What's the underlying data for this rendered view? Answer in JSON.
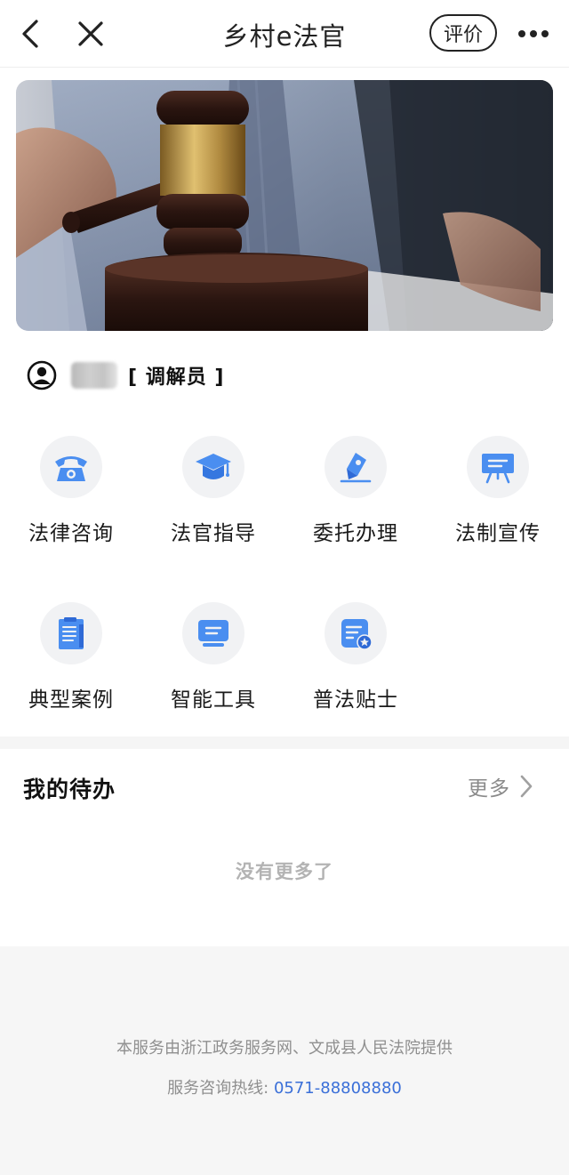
{
  "header": {
    "title": "乡村e法官",
    "rate_label": "评价"
  },
  "user": {
    "role": "[ 调解员 ]"
  },
  "services": [
    {
      "label": "法律咨询",
      "icon": "telephone-icon"
    },
    {
      "label": "法官指导",
      "icon": "graduation-cap-icon"
    },
    {
      "label": "委托办理",
      "icon": "pen-sign-icon"
    },
    {
      "label": "法制宣传",
      "icon": "presentation-board-icon"
    },
    {
      "label": "典型案例",
      "icon": "clipboard-document-icon"
    },
    {
      "label": "智能工具",
      "icon": "computer-terminal-icon"
    },
    {
      "label": "普法贴士",
      "icon": "note-star-icon"
    }
  ],
  "todo": {
    "title": "我的待办",
    "more_label": "更多",
    "empty_text": "没有更多了"
  },
  "footer": {
    "provider_text": "本服务由浙江政务服务网、文成县人民法院提供",
    "hotline_label": "服务咨询热线:",
    "hotline_number": "0571-88808880"
  },
  "colors": {
    "accent_blue": "#3a6fd8",
    "icon_blue": "#4a8ef0",
    "icon_bg": "#f1f2f4",
    "footer_bg": "#f6f6f6"
  }
}
